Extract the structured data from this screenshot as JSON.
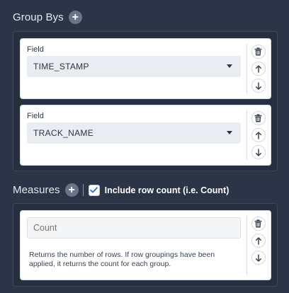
{
  "group_bys": {
    "title": "Group Bys",
    "add_label": "+",
    "items": [
      {
        "field_label": "Field",
        "value": "TIME_STAMP"
      },
      {
        "field_label": "Field",
        "value": "TRACK_NAME"
      }
    ]
  },
  "measures": {
    "title": "Measures",
    "add_label": "+",
    "include_row_count": {
      "label": "Include row count (i.e. Count)",
      "checked": true
    },
    "items": [
      {
        "placeholder": "Count",
        "description": "Returns the number of rows. If row groupings have been applied, it returns the count for each group."
      }
    ]
  },
  "colors": {
    "background": "#2b3547",
    "card": "#ffffff",
    "select_bg": "#e9edf1",
    "checkbox_accent": "#2e6fd0",
    "icon": "#3b4656"
  },
  "icons": [
    "plus-icon",
    "trash-icon",
    "arrow-up-icon",
    "arrow-down-icon",
    "chevron-down-icon",
    "checkmark-icon"
  ]
}
